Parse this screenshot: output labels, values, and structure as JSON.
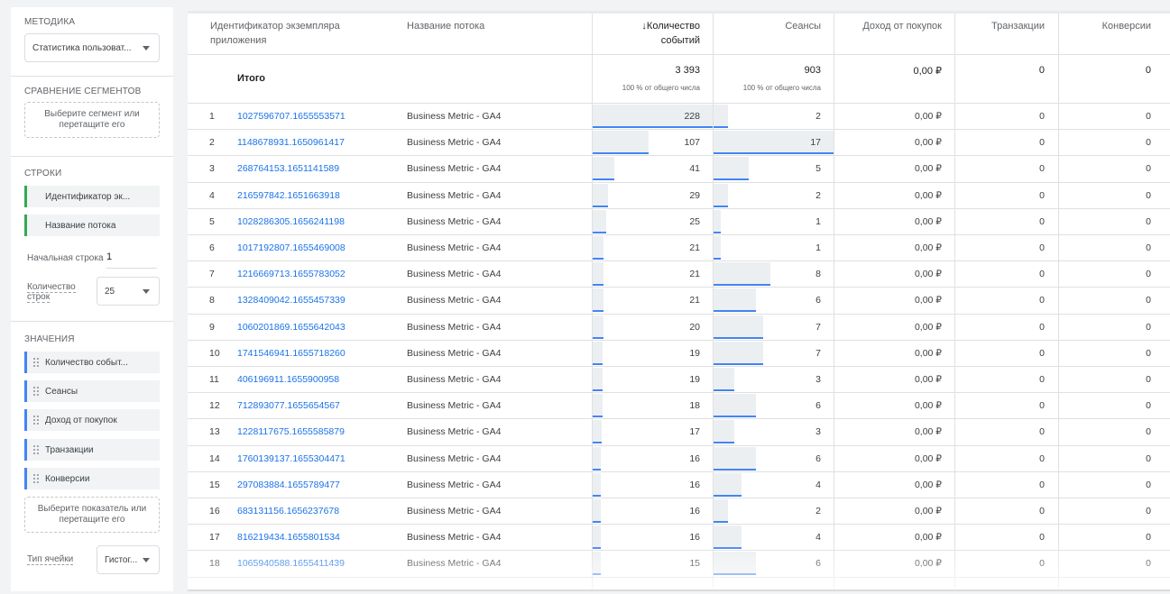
{
  "sidebar": {
    "method_title": "МЕТОДИКА",
    "method_value": "Статистика пользоват...",
    "compare_title": "СРАВНЕНИЕ СЕГМЕНТОВ",
    "compare_drop": "Выберите сегмент или перетащите его",
    "rows_title": "СТРОКИ",
    "row_chips": [
      "Идентификатор эк...",
      "Название потока"
    ],
    "start_row_label": "Начальная строка",
    "start_row_value": "1",
    "row_count_label": "Количество строк",
    "row_count_value": "25",
    "values_title": "ЗНАЧЕНИЯ",
    "value_chips": [
      "Количество событ...",
      "Сеансы",
      "Доход от покупок",
      "Транзакции",
      "Конверсии"
    ],
    "values_drop": "Выберите показатель или перетащите его",
    "cell_type_label": "Тип ячейки",
    "cell_type_value": "Гистог..."
  },
  "table": {
    "headers": {
      "app_id": "Идентификатор экземпляра приложения",
      "stream": "Название потока",
      "events": "↓Количество событий",
      "sessions": "Сеансы",
      "revenue": "Доход от покупок",
      "transactions": "Транзакции",
      "conversions": "Конверсии"
    },
    "totals": {
      "label": "Итого",
      "events": "3 393",
      "events_sub": "100 % от общего числа",
      "sessions": "903",
      "sessions_sub": "100 % от общего числа",
      "revenue": "0,00 ₽",
      "transactions": "0",
      "conversions": "0"
    },
    "rows": [
      {
        "n": "1",
        "id": "1027596707.1655553571",
        "stream": "Business Metric - GA4",
        "events": "228",
        "sessions": "2",
        "revenue": "0,00 ₽",
        "transactions": "0",
        "conversions": "0",
        "events_bar": 1.0,
        "sessions_bar": 0.118
      },
      {
        "n": "2",
        "id": "1148678931.1650961417",
        "stream": "Business Metric - GA4",
        "events": "107",
        "sessions": "17",
        "revenue": "0,00 ₽",
        "transactions": "0",
        "conversions": "0",
        "events_bar": 0.469,
        "sessions_bar": 1.0
      },
      {
        "n": "3",
        "id": "268764153.1651141589",
        "stream": "Business Metric - GA4",
        "events": "41",
        "sessions": "5",
        "revenue": "0,00 ₽",
        "transactions": "0",
        "conversions": "0",
        "events_bar": 0.18,
        "sessions_bar": 0.294
      },
      {
        "n": "4",
        "id": "216597842.1651663918",
        "stream": "Business Metric - GA4",
        "events": "29",
        "sessions": "2",
        "revenue": "0,00 ₽",
        "transactions": "0",
        "conversions": "0",
        "events_bar": 0.127,
        "sessions_bar": 0.118
      },
      {
        "n": "5",
        "id": "1028286305.1656241198",
        "stream": "Business Metric - GA4",
        "events": "25",
        "sessions": "1",
        "revenue": "0,00 ₽",
        "transactions": "0",
        "conversions": "0",
        "events_bar": 0.11,
        "sessions_bar": 0.059
      },
      {
        "n": "6",
        "id": "1017192807.1655469008",
        "stream": "Business Metric - GA4",
        "events": "21",
        "sessions": "1",
        "revenue": "0,00 ₽",
        "transactions": "0",
        "conversions": "0",
        "events_bar": 0.092,
        "sessions_bar": 0.059
      },
      {
        "n": "7",
        "id": "1216669713.1655783052",
        "stream": "Business Metric - GA4",
        "events": "21",
        "sessions": "8",
        "revenue": "0,00 ₽",
        "transactions": "0",
        "conversions": "0",
        "events_bar": 0.092,
        "sessions_bar": 0.471
      },
      {
        "n": "8",
        "id": "1328409042.1655457339",
        "stream": "Business Metric - GA4",
        "events": "21",
        "sessions": "6",
        "revenue": "0,00 ₽",
        "transactions": "0",
        "conversions": "0",
        "events_bar": 0.092,
        "sessions_bar": 0.353
      },
      {
        "n": "9",
        "id": "1060201869.1655642043",
        "stream": "Business Metric - GA4",
        "events": "20",
        "sessions": "7",
        "revenue": "0,00 ₽",
        "transactions": "0",
        "conversions": "0",
        "events_bar": 0.088,
        "sessions_bar": 0.412
      },
      {
        "n": "10",
        "id": "1741546941.1655718260",
        "stream": "Business Metric - GA4",
        "events": "19",
        "sessions": "7",
        "revenue": "0,00 ₽",
        "transactions": "0",
        "conversions": "0",
        "events_bar": 0.083,
        "sessions_bar": 0.412
      },
      {
        "n": "11",
        "id": "406196911.1655900958",
        "stream": "Business Metric - GA4",
        "events": "19",
        "sessions": "3",
        "revenue": "0,00 ₽",
        "transactions": "0",
        "conversions": "0",
        "events_bar": 0.083,
        "sessions_bar": 0.176
      },
      {
        "n": "12",
        "id": "712893077.1655654567",
        "stream": "Business Metric - GA4",
        "events": "18",
        "sessions": "6",
        "revenue": "0,00 ₽",
        "transactions": "0",
        "conversions": "0",
        "events_bar": 0.079,
        "sessions_bar": 0.353
      },
      {
        "n": "13",
        "id": "1228117675.1655585879",
        "stream": "Business Metric - GA4",
        "events": "17",
        "sessions": "3",
        "revenue": "0,00 ₽",
        "transactions": "0",
        "conversions": "0",
        "events_bar": 0.075,
        "sessions_bar": 0.176
      },
      {
        "n": "14",
        "id": "1760139137.1655304471",
        "stream": "Business Metric - GA4",
        "events": "16",
        "sessions": "6",
        "revenue": "0,00 ₽",
        "transactions": "0",
        "conversions": "0",
        "events_bar": 0.07,
        "sessions_bar": 0.353
      },
      {
        "n": "15",
        "id": "297083884.1655789477",
        "stream": "Business Metric - GA4",
        "events": "16",
        "sessions": "4",
        "revenue": "0,00 ₽",
        "transactions": "0",
        "conversions": "0",
        "events_bar": 0.07,
        "sessions_bar": 0.235
      },
      {
        "n": "16",
        "id": "683131156.1656237678",
        "stream": "Business Metric - GA4",
        "events": "16",
        "sessions": "2",
        "revenue": "0,00 ₽",
        "transactions": "0",
        "conversions": "0",
        "events_bar": 0.07,
        "sessions_bar": 0.118
      },
      {
        "n": "17",
        "id": "816219434.1655801534",
        "stream": "Business Metric - GA4",
        "events": "16",
        "sessions": "4",
        "revenue": "0,00 ₽",
        "transactions": "0",
        "conversions": "0",
        "events_bar": 0.07,
        "sessions_bar": 0.235
      },
      {
        "n": "18",
        "id": "1065940588.1655411439",
        "stream": "Business Metric - GA4",
        "events": "15",
        "sessions": "6",
        "revenue": "0,00 ₽",
        "transactions": "0",
        "conversions": "0",
        "events_bar": 0.066,
        "sessions_bar": 0.353
      }
    ]
  },
  "colors": {
    "accent": "#1a73e8",
    "bar_fill": "#eceff1",
    "bar_line": "#4285f4",
    "dimension_chip": "#34a853",
    "metric_chip": "#4285f4"
  }
}
